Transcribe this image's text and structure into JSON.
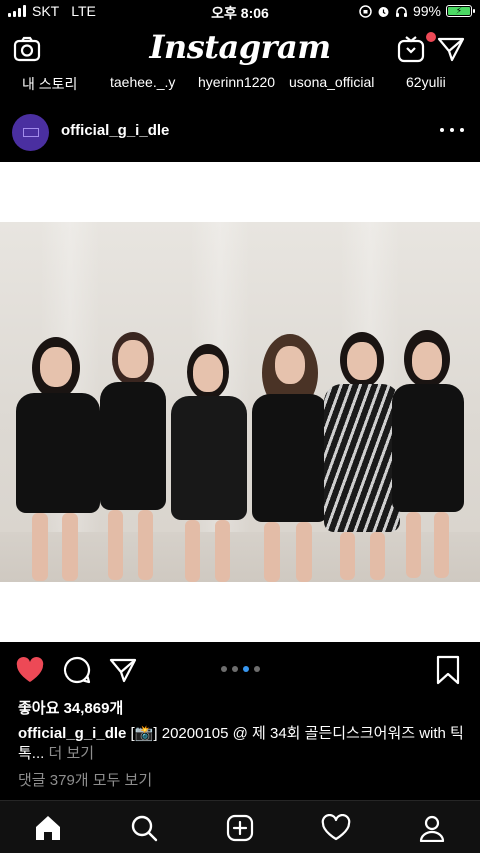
{
  "status_bar": {
    "carrier": "SKT",
    "network": "LTE",
    "time": "오후 8:06",
    "battery": "99%",
    "battery_level": 0.99
  },
  "header": {
    "logo": "Instagram",
    "icons": [
      "camera-icon",
      "igtv-icon",
      "direct-message-icon"
    ]
  },
  "stories": [
    {
      "label": "내 스토리"
    },
    {
      "label": "taehee._.y"
    },
    {
      "label": "hyerinn1220"
    },
    {
      "label": "usona_official"
    },
    {
      "label": "62yulii"
    }
  ],
  "post": {
    "username": "official_g_i_dle",
    "likes": "좋아요 34,869개",
    "caption_user": "official_g_i_dle",
    "caption_text": " [📸] 20200105 @ 제 34회 골든디스크어워즈 with 틱톡...",
    "caption_more": " 더 보기",
    "comments": "댓글 379개 모두 보기",
    "carousel_total": 4,
    "carousel_active": 3
  },
  "bottom_nav": [
    "home-icon",
    "search-icon",
    "new-post-icon",
    "activity-icon",
    "profile-icon"
  ],
  "colors": {
    "background": "#000000",
    "like": "#ed4956",
    "carousel_active": "#3897f0",
    "battery": "#4cd964",
    "muted_text": "#8e8e8e"
  }
}
